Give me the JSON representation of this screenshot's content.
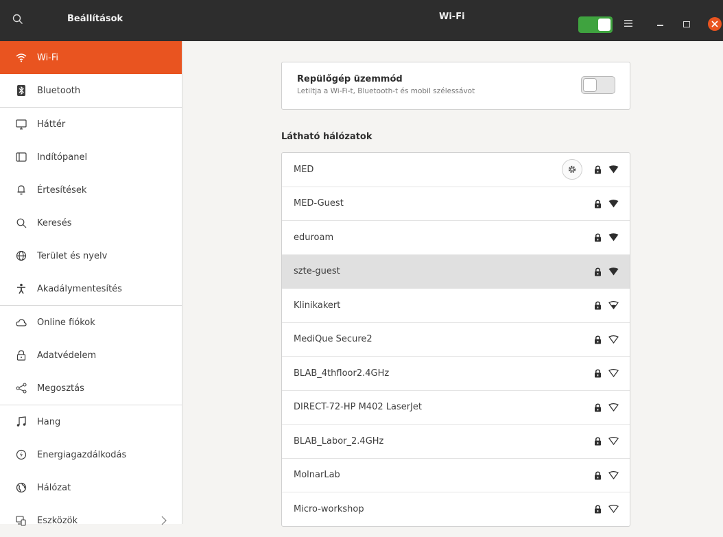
{
  "header": {
    "sidebar_title": "Beállítások",
    "page_title": "Wi-Fi",
    "wifi_enabled": true
  },
  "sidebar": {
    "items": [
      {
        "label": "Wi-Fi",
        "icon": "wifi-icon",
        "active": true
      },
      {
        "label": "Bluetooth",
        "icon": "bluetooth-icon"
      },
      {
        "label": "Háttér",
        "icon": "background-icon"
      },
      {
        "label": "Indítópanel",
        "icon": "dock-icon"
      },
      {
        "label": "Értesítések",
        "icon": "bell-icon"
      },
      {
        "label": "Keresés",
        "icon": "search-icon"
      },
      {
        "label": "Terület és nyelv",
        "icon": "globe-icon"
      },
      {
        "label": "Akadálymentesítés",
        "icon": "accessibility-icon"
      },
      {
        "label": "Online fiókok",
        "icon": "cloud-icon"
      },
      {
        "label": "Adatvédelem",
        "icon": "lock-icon"
      },
      {
        "label": "Megosztás",
        "icon": "share-icon"
      },
      {
        "label": "Hang",
        "icon": "music-icon"
      },
      {
        "label": "Energiagazdálkodás",
        "icon": "power-icon"
      },
      {
        "label": "Hálózat",
        "icon": "network-icon"
      },
      {
        "label": "Eszközök",
        "icon": "devices-icon"
      }
    ]
  },
  "airplane": {
    "title": "Repülőgép üzemmód",
    "subtitle": "Letiltja a Wi-Fi-t, Bluetooth-t és mobil szélessávot",
    "enabled": false
  },
  "networks": {
    "heading": "Látható hálózatok",
    "items": [
      {
        "name": "MED",
        "secured": true,
        "signal": "strong",
        "connected": true
      },
      {
        "name": "MED-Guest",
        "secured": true,
        "signal": "strong"
      },
      {
        "name": "eduroam",
        "secured": true,
        "signal": "strong"
      },
      {
        "name": "szte-guest",
        "secured": true,
        "signal": "strong",
        "selected": true
      },
      {
        "name": "Klinikakert",
        "secured": true,
        "signal": "weak"
      },
      {
        "name": "MediQue Secure2",
        "secured": true,
        "signal": "weak"
      },
      {
        "name": "BLAB_4thfloor2.4GHz",
        "secured": true,
        "signal": "weak"
      },
      {
        "name": "DIRECT-72-HP M402 LaserJet",
        "secured": true,
        "signal": "weak"
      },
      {
        "name": "BLAB_Labor_2.4GHz",
        "secured": true,
        "signal": "weak"
      },
      {
        "name": "MolnarLab",
        "secured": true,
        "signal": "weak"
      },
      {
        "name": "Micro-workshop",
        "secured": true,
        "signal": "weak"
      }
    ]
  },
  "colors": {
    "accent": "#e95420",
    "switch_on": "#3fa33f",
    "headerbar": "#2d2d2d"
  }
}
